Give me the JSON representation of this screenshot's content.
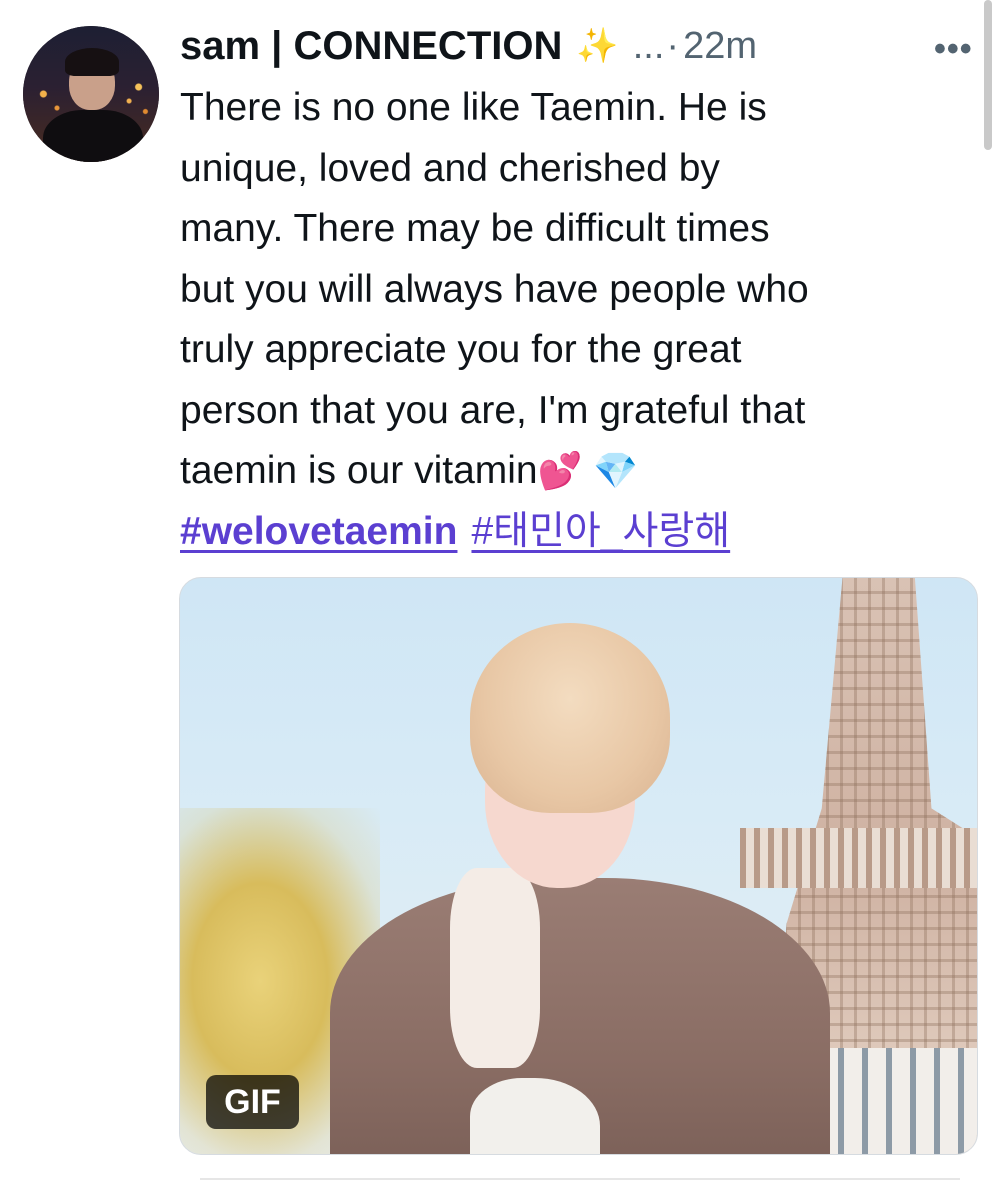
{
  "tweet": {
    "author": {
      "display_name": "sam | CONNECTION",
      "name_emoji": "✨",
      "truncation": "...",
      "separator": "·",
      "timestamp": "22m"
    },
    "more_label": "•••",
    "text_lines": [
      "There is no one like Taemin. He is",
      "unique, loved and cherished by",
      "many. There may be difficult times",
      "but you will always have people who",
      "truly appreciate you for the great",
      "person that you are, I'm grateful that",
      "taemin is our vitamin"
    ],
    "text_emojis": [
      "💕",
      "💎"
    ],
    "hashtags": [
      "#welovetaemin",
      "#태민아_사랑해"
    ],
    "media": {
      "badge": "GIF"
    }
  },
  "colors": {
    "text": "#0f1419",
    "secondary": "#536471",
    "hashtag": "#5b3fd1"
  }
}
